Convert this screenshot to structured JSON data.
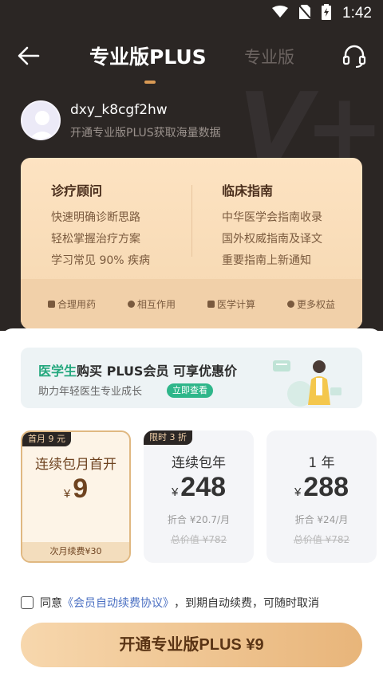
{
  "status_bar": {
    "time": "1:42"
  },
  "nav": {
    "tab_active": "专业版PLUS",
    "tab_inactive": "专业版"
  },
  "user": {
    "name": "dxy_k8cgf2hw",
    "subtitle": "开通专业版PLUS获取海量数据"
  },
  "benefits": {
    "columns": [
      {
        "title": "诊疗顾问",
        "lines": [
          "快速明确诊断思路",
          "轻松掌握治疗方案",
          "学习常见 90% 疾病"
        ]
      },
      {
        "title": "临床指南",
        "lines": [
          "中华医学会指南收录",
          "国外权威指南及译文",
          "重要指南上新通知"
        ]
      }
    ],
    "footer": [
      "合理用药",
      "相互作用",
      "医学计算",
      "更多权益"
    ]
  },
  "promo": {
    "highlight": "医学生",
    "title_rest": "购买 PLUS会员 可享优惠价",
    "subtitle": "助力年轻医生专业成长",
    "button": "立即查看"
  },
  "plans": [
    {
      "badge": "首月 9 元",
      "name": "连续包月首开",
      "currency": "¥",
      "price": "9",
      "footer": "次月续费¥30"
    },
    {
      "badge": "限时 3 折",
      "name": "连续包年",
      "currency": "¥",
      "price": "248",
      "per": "折合 ¥20.7/月",
      "orig": "总价值 ¥782"
    },
    {
      "name": "1 年",
      "currency": "¥",
      "price": "288",
      "per": "折合 ¥24/月",
      "orig": "总价值 ¥782"
    }
  ],
  "agreement": {
    "prefix": "同意",
    "link": "《会员自动续费协议》",
    "suffix": "，到期自动续费，可随时取消"
  },
  "cta": {
    "label": "开通专业版PLUS ¥9"
  },
  "colors": {
    "dark_bg": "#2b2624",
    "gold": "#f5d7b0",
    "accent_green": "#25a87e",
    "price_brown": "#6e4320"
  }
}
